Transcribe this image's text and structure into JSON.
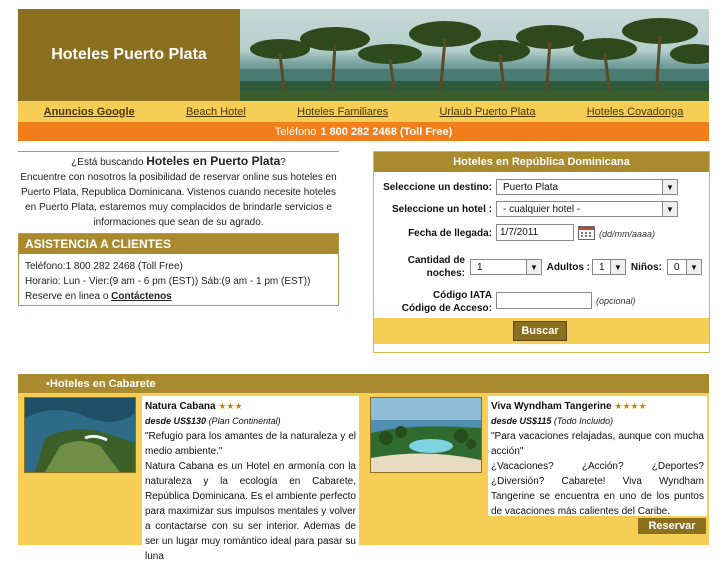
{
  "header": {
    "brand": "Hoteles Puerto Plata"
  },
  "nav": {
    "items": [
      "Anuncios Google",
      "Beach Hotel",
      "Hoteles Familiares",
      "Urlaub Puerto Plata",
      "Hoteles Covadonga"
    ]
  },
  "phonebar": {
    "prefix": "Teléfono",
    "number": "1 800 282 2468 (Toll Free)"
  },
  "intro": {
    "lead_pre": "¿Está buscando ",
    "lead_strong": "Hoteles en Puerto Plata",
    "lead_post": "?",
    "body": "Encuentre con nosotros la posibilidad de reservar online sus hoteles en Puerto Plata, Republica Dominicana. Vistenos cuando necesite hoteles en Puerto Plata, estaremos muy complacidos de brindarle servicios e informaciones que sean de su agrado."
  },
  "assistance": {
    "title": "ASISTENCIA A CLIENTES",
    "phone": "Teléfono:1 800 282 2468 (Toll Free)",
    "hours": "Horario: Lun - Vier:(9 am - 6 pm (EST)) Sáb:(9 am - 1 pm (EST))",
    "online_pre": "Reserve en linea o ",
    "online_link": "Contáctenos"
  },
  "form": {
    "title": "Hoteles en República Dominicana",
    "destination_label": "Seleccione un destino:",
    "destination_value": "Puerto Plata",
    "hotel_label": "Seleccione un hotel :",
    "hotel_value": "- cualquier hotel -",
    "arrival_label": "Fecha de llegada:",
    "arrival_value": "1/7/2011",
    "arrival_hint": "(dd/mm/aaaa)",
    "nights_label_1": "Cantidad de",
    "nights_label_2": "noches:",
    "nights_value": "1",
    "adults_label": "Adultos :",
    "adults_value": "1",
    "children_label": "Niños:",
    "children_value": "0",
    "iata_label_1": "Código IATA",
    "iata_label_2": "Código de Acceso:",
    "iata_value": "",
    "iata_hint": "(opcional)",
    "search_button": "Buscar"
  },
  "hotels": {
    "section_title": "Hoteles en Cabarete",
    "items": [
      {
        "name": "Natura Cabana",
        "stars": "★★★",
        "price_label": "desde US$130",
        "price_plan": "(Plan Continental)",
        "quote": "\"Refugio para los amantes de la naturaleza y el medio ambiente.\"",
        "description": "Natura Cabana es un Hotel en armonía con la naturaleza y la ecología en Cabarete, República Dominicana. Es el ambiente perfecto para maximizar sus impulsos mentales y volver a contactarse con su ser interior. Ademas de ser un lugar muy romántico ideal para pasar su luna"
      },
      {
        "name": "Viva Wyndham Tangerine",
        "stars": "★★★★",
        "price_label": "desde US$115",
        "price_plan": "(Todo Incluido)",
        "quote": "\"Para vacaciones relajadas, aunque con mucha acción\"",
        "description": "¿Vacaciones? ¿Acción? ¿Deportes? ¿Diversión? Cabarete! Viva Wyndham Tangerine se encuentra en uno de los puntos de vacaciones más calientes del Caribe.",
        "reserve_button": "Reservar"
      }
    ]
  }
}
